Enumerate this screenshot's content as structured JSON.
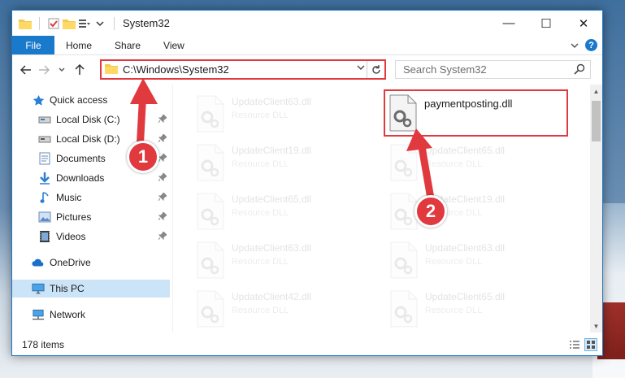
{
  "window": {
    "title": "System32",
    "controls": {
      "minimize": "—",
      "maximize": "☐",
      "close": "✕"
    }
  },
  "ribbon": {
    "tabs": [
      "File",
      "Home",
      "Share",
      "View"
    ],
    "help": "?"
  },
  "nav": {
    "address": "C:\\Windows\\System32",
    "search_placeholder": "Search System32"
  },
  "sidebar": {
    "items": [
      {
        "label": "Quick access",
        "icon": "star-icon",
        "pinned": false
      },
      {
        "label": "Local Disk (C:)",
        "icon": "drive-icon",
        "pinned": true
      },
      {
        "label": "Local Disk (D:)",
        "icon": "drive-icon",
        "pinned": true
      },
      {
        "label": "Documents",
        "icon": "documents-icon",
        "pinned": true
      },
      {
        "label": "Downloads",
        "icon": "download-icon",
        "pinned": true
      },
      {
        "label": "Music",
        "icon": "music-icon",
        "pinned": true
      },
      {
        "label": "Pictures",
        "icon": "pictures-icon",
        "pinned": true
      },
      {
        "label": "Videos",
        "icon": "videos-icon",
        "pinned": true
      },
      {
        "label": "OneDrive",
        "icon": "cloud-icon",
        "pinned": false
      },
      {
        "label": "This PC",
        "icon": "monitor-icon",
        "pinned": false,
        "selected": true
      },
      {
        "label": "Network",
        "icon": "network-icon",
        "pinned": false
      }
    ]
  },
  "files": {
    "left_column": [
      {
        "name": "UpdateClient63.dll",
        "type": "Resource DLL"
      },
      {
        "name": "UpdateClient19.dll",
        "type": "Resource DLL"
      },
      {
        "name": "UpdateClient65.dll",
        "type": "Resource DLL"
      },
      {
        "name": "UpdateClient63.dll",
        "type": "Resource DLL"
      },
      {
        "name": "UpdateClient42.dll",
        "type": "Resource DLL"
      }
    ],
    "right_column": [
      {
        "name": "paymentposting.dll",
        "type": ""
      },
      {
        "name": "UpdateClient65.dll",
        "type": "Resource DLL"
      },
      {
        "name": "UpdateClient19.dll",
        "type": "Resource DLL"
      },
      {
        "name": "UpdateClient63.dll",
        "type": "Resource DLL"
      },
      {
        "name": "UpdateClient65.dll",
        "type": "Resource DLL"
      }
    ]
  },
  "status": {
    "item_count": "178 items"
  },
  "annotations": {
    "step1": "1",
    "step2": "2",
    "accent_color": "#e0393e"
  }
}
